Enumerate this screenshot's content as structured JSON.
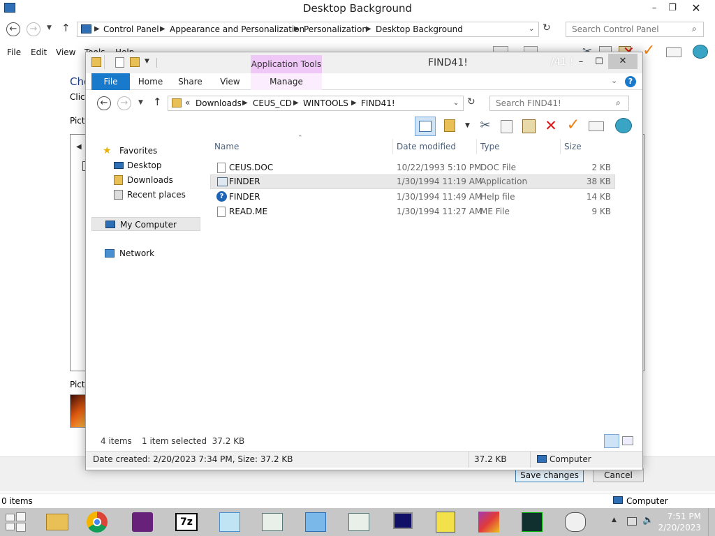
{
  "bg_window": {
    "title": "Desktop Background",
    "breadcrumb": [
      "Control Panel",
      "Appearance and Personalization",
      "Personalization",
      "Desktop Background"
    ],
    "search_placeholder": "Search Control Panel",
    "menu": [
      "File",
      "Edit",
      "View",
      "Tools",
      "Help"
    ],
    "partial_heading": "Cho",
    "partial_text": "Click",
    "partial_label1": "Pictu",
    "partial_label2": "Pictu",
    "status": "0 items",
    "computer_label": "Computer",
    "save_label": "Save changes",
    "cancel_label": "Cancel"
  },
  "explorer": {
    "title": "FIND41!",
    "ghost_title": "/41 !",
    "app_tools_label": "Application Tools",
    "tabs": [
      "File",
      "Home",
      "Share",
      "View"
    ],
    "manage_label": "Manage",
    "breadcrumb_prefix": "«",
    "breadcrumb": [
      "Downloads",
      "CEUS_CD",
      "WINTOOLS",
      "FIND41!"
    ],
    "search_placeholder": "Search FIND41!",
    "nav": {
      "favorites": "Favorites",
      "desktop": "Desktop",
      "downloads": "Downloads",
      "recent": "Recent places",
      "computer": "My Computer",
      "network": "Network"
    },
    "columns": [
      "Name",
      "Date modified",
      "Type",
      "Size"
    ],
    "files": [
      {
        "name": "CEUS.DOC",
        "date": "10/22/1993 5:10 PM",
        "type": "DOC File",
        "size": "2 KB"
      },
      {
        "name": "FINDER",
        "date": "1/30/1994 11:19 AM",
        "type": "Application",
        "size": "38 KB"
      },
      {
        "name": "FINDER",
        "date": "1/30/1994 11:49 AM",
        "type": "Help file",
        "size": "14 KB"
      },
      {
        "name": "READ.ME",
        "date": "1/30/1994 11:27 AM",
        "type": "ME File",
        "size": "9 KB"
      }
    ],
    "status_items": "4 items",
    "status_selected": "1 item selected  37.2 KB",
    "details_text": "Date created: 2/20/2023 7:34 PM, Size: 37.2 KB",
    "details_size": "37.2 KB",
    "details_location": "Computer"
  },
  "taskbar": {
    "time": "7:51 PM",
    "date": "2/20/2023",
    "apps": [
      "file-explorer-icon",
      "chrome-icon",
      "visual-studio-icon",
      "7zip-icon",
      "remote-desktop-icon",
      "window-app-icon",
      "control-panel-icon",
      "window-app-icon",
      "monitor-app-icon",
      "floppy-app-icon",
      "paint-app-icon",
      "terminal-app-icon",
      "disk-app-icon"
    ]
  },
  "colors": {
    "accent_blue": "#1979ca",
    "app_tools_pink": "#f0c8f8",
    "taskbar_gray": "#c7c7c7",
    "selection_gray": "#e8e8e8"
  }
}
